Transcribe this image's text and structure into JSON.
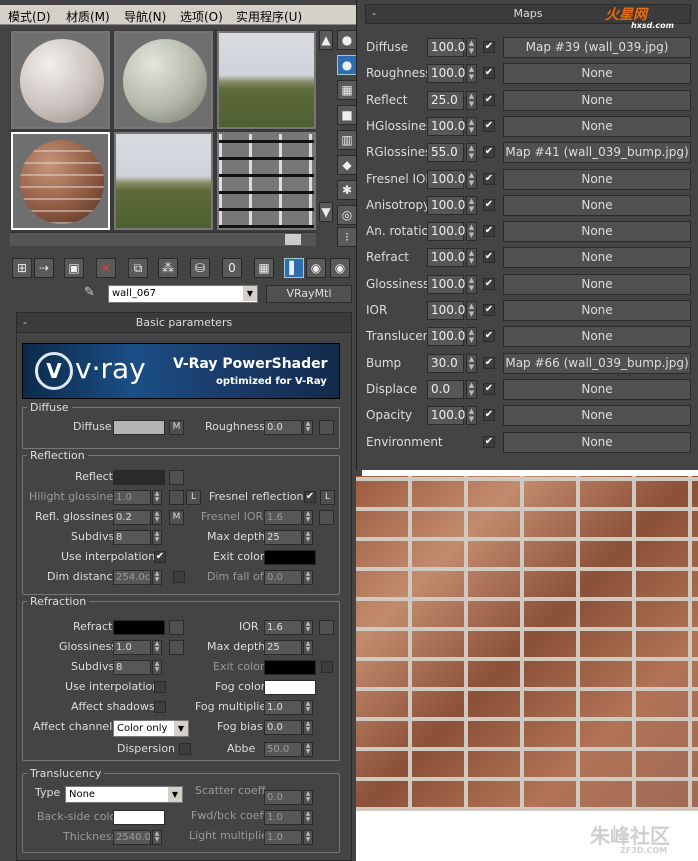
{
  "menubar": {
    "items": [
      "模式(D)",
      "材质(M)",
      "导航(N)",
      "选项(O)",
      "实用程序(U)"
    ]
  },
  "material": {
    "name": "wall_067",
    "type": "VRayMtl"
  },
  "basic": {
    "header": "Basic parameters",
    "banner": {
      "brand": "v·ray",
      "title": "V-Ray PowerShader",
      "subtitle": "optimized for V-Ray"
    },
    "diffuse": {
      "group": "Diffuse",
      "label": "Diffuse",
      "m": "M",
      "roughness_label": "Roughness",
      "roughness": "0.0",
      "color": "#b4b4b4"
    },
    "reflection": {
      "group": "Reflection",
      "reflect_label": "Reflect",
      "reflect_color": "#2a2a2a",
      "hilight_label": "Hilight glossiness",
      "hilight": "1.0",
      "l": "L",
      "fresnel_label": "Fresnel reflections",
      "refl_gloss_label": "Refl. glossiness",
      "refl_gloss": "0.2",
      "m": "M",
      "fresnel_ior_label": "Fresnel IOR",
      "fresnel_ior": "1.6",
      "subdivs_label": "Subdivs",
      "subdivs": "8",
      "max_depth_label": "Max depth",
      "max_depth": "25",
      "use_interp_label": "Use interpolation",
      "exit_color_label": "Exit color",
      "exit_color": "#000000",
      "dim_distance_label": "Dim distance",
      "dim_distance": "254.0c",
      "dim_falloff_label": "Dim fall off",
      "dim_falloff": "0.0"
    },
    "refraction": {
      "group": "Refraction",
      "refract_label": "Refract",
      "refract_color": "#000000",
      "ior_label": "IOR",
      "ior": "1.6",
      "gloss_label": "Glossiness",
      "gloss": "1.0",
      "max_depth_label": "Max depth",
      "max_depth": "25",
      "subdivs_label": "Subdivs",
      "subdivs": "8",
      "exit_color_label": "Exit color",
      "exit_color": "#000000",
      "use_interp_label": "Use interpolation",
      "fog_color_label": "Fog color",
      "fog_color": "#ffffff",
      "affect_shadows_label": "Affect shadows",
      "fog_mult_label": "Fog multiplier",
      "fog_mult": "1.0",
      "affect_channels_label": "Affect channels",
      "affect_channels": "Color only",
      "fog_bias_label": "Fog bias",
      "fog_bias": "0.0",
      "dispersion_label": "Dispersion",
      "abbe_label": "Abbe",
      "abbe": "50.0"
    },
    "translucency": {
      "group": "Translucency",
      "type_label": "Type",
      "type": "None",
      "scatter_label": "Scatter coeff",
      "scatter": "0.0",
      "backside_label": "Back-side color",
      "backside_color": "#ffffff",
      "fwd_label": "Fwd/bck coeff",
      "fwd": "1.0",
      "thickness_label": "Thickness",
      "thickness": "2540.0",
      "light_mult_label": "Light multiplier",
      "light_mult": "1.0"
    }
  },
  "maps": {
    "header": "Maps",
    "rows": [
      {
        "label": "Diffuse",
        "value": "100.0",
        "map": "Map #39 (wall_039.jpg)"
      },
      {
        "label": "Roughness",
        "value": "100.0",
        "map": "None"
      },
      {
        "label": "Reflect",
        "value": "25.0",
        "map": "None"
      },
      {
        "label": "HGlossiness",
        "value": "100.0",
        "map": "None"
      },
      {
        "label": "RGlossiness",
        "value": "55.0",
        "map": "Map #41 (wall_039_bump.jpg)"
      },
      {
        "label": "Fresnel IOR",
        "value": "100.0",
        "map": "None"
      },
      {
        "label": "Anisotropy",
        "value": "100.0",
        "map": "None"
      },
      {
        "label": "An. rotation",
        "value": "100.0",
        "map": "None"
      },
      {
        "label": "Refract",
        "value": "100.0",
        "map": "None"
      },
      {
        "label": "Glossiness",
        "value": "100.0",
        "map": "None"
      },
      {
        "label": "IOR",
        "value": "100.0",
        "map": "None"
      },
      {
        "label": "Translucent",
        "value": "100.0",
        "map": "None"
      },
      {
        "label": "Bump",
        "value": "30.0",
        "map": "Map #66 (wall_039_bump.jpg)"
      },
      {
        "label": "Displace",
        "value": "0.0",
        "map": "None"
      },
      {
        "label": "Opacity",
        "value": "100.0",
        "map": "None"
      },
      {
        "label": "Environment",
        "value": "",
        "map": "None"
      }
    ]
  },
  "branding": {
    "logo": "火星网",
    "logo_url": "hxsd.com",
    "watermark": "朱峰社区",
    "watermark_url": "ZF3D.COM"
  }
}
